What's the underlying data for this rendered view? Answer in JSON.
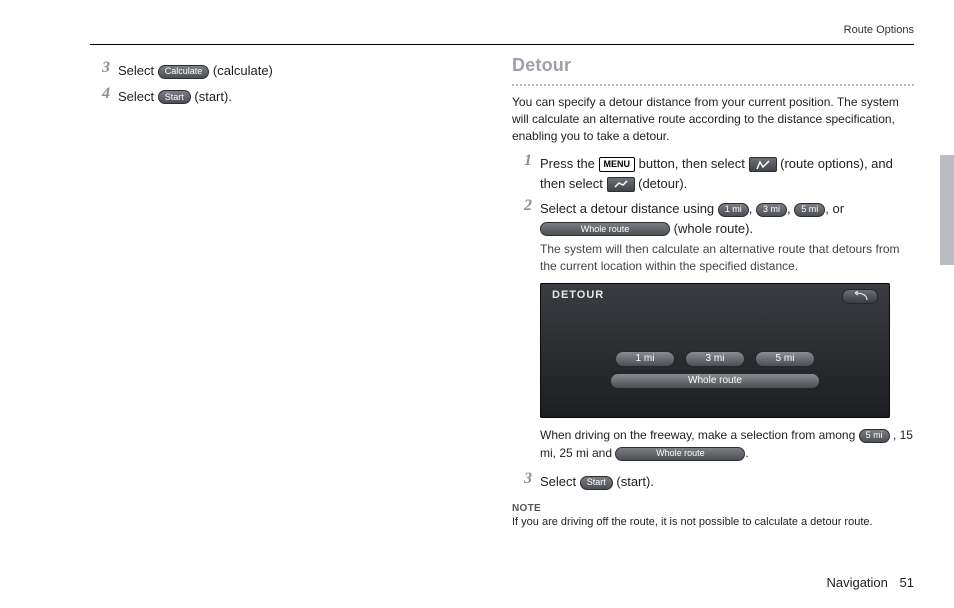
{
  "header": {
    "running": "Route Options"
  },
  "left": {
    "steps": [
      {
        "num": "3",
        "lead": "Select ",
        "btn": "Calculate",
        "tail": " (calculate)"
      },
      {
        "num": "4",
        "lead": "Select ",
        "btn": "Start",
        "tail": " (start)."
      }
    ]
  },
  "right": {
    "title": "Detour",
    "intro": "You can specify a detour distance from your current position. The system will calculate an alternative route according to the distance specification, enabling you to take a detour.",
    "step1": {
      "num": "1",
      "a": "Press the ",
      "menu": "MENU",
      "b": " button, then select ",
      "c": " (route options), and then select ",
      "d": " (detour)."
    },
    "step2": {
      "num": "2",
      "a": "Select a detour distance using ",
      "p1": "1 mi",
      "p2": "3 mi",
      "p3": "5 mi",
      "b": ", ",
      "c": ", ",
      "d": ", or ",
      "whole": "Whole route",
      "e": " (whole route).",
      "sub": "The system will then calculate an alternative route that detours from the current location within the specified distance."
    },
    "screenshot": {
      "title": "DETOUR",
      "b1": "1 mi",
      "b2": "3 mi",
      "b3": "5 mi",
      "whole": "Whole route"
    },
    "afterscr": {
      "a": "When driving on the freeway, make a selection from among ",
      "p5": "5 mi",
      "b": ", 15 mi, 25 mi and ",
      "whole": "Whole route",
      "c": "."
    },
    "step3": {
      "num": "3",
      "a": "Select ",
      "btn": "Start",
      "b": " (start)."
    },
    "note": {
      "head": "NOTE",
      "body": "If you are driving off the route, it is not possible to calculate a detour route."
    }
  },
  "footer": {
    "section": "Navigation",
    "page": "51"
  }
}
